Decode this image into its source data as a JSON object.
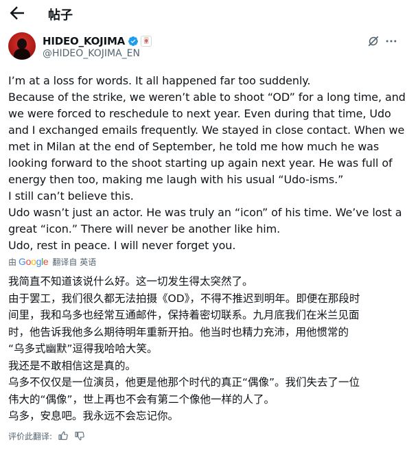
{
  "header": {
    "title": "帖子",
    "back_icon": "arrow-left-icon"
  },
  "author": {
    "display_name": "HIDEO_KOJIMA",
    "handle": "@HIDEO_KOJIMA_EN",
    "verified_icon": "verified-badge-icon",
    "affiliate_icon": "affiliate-badge-icon",
    "affiliate_text": "🀄"
  },
  "actions": {
    "grok_icon": "grok-icon",
    "more_icon": "more-icon"
  },
  "tweet": {
    "lines": [
      "I’m at a loss for words. It all happened far too suddenly.",
      "Because of the strike, we weren’t able to shoot “OD” for a long time, and",
      "we were forced to reschedule to next year. Even during that time, Udo",
      "and I exchanged emails frequently. We stayed in close contact. When we",
      "met in Milan at the end of September, he told me how much he was",
      "looking forward to the shoot starting up again next year. He was full of",
      "energy then too, making me laugh with his usual “Udo-isms.”",
      "I still can’t believe this.",
      "Udo wasn’t just an actor. He was truly an “icon” of his time. We’ve lost a",
      "great “icon.” There will never be another like him.",
      "Udo, rest in peace. I will never forget you."
    ]
  },
  "translation": {
    "by_label": "由",
    "google": "Google",
    "link_label": "翻译自 英语",
    "lines": [
      "我简直不知道该说什么好。这一切发生得太突然了。",
      "由于罢工，我们很久都无法拍摄《OD》，不得不推迟到明年。即便在那段时",
      "间里，我和乌多也经常互通邮件，保持着密切联系。九月底我们在米兰见面",
      "时，他告诉我他多么期待明年重新开拍。他当时也精力充沛，用他惯常的",
      "“乌多式幽默”逗得我哈哈大笑。",
      "我还是不敢相信这是真的。",
      "乌多不仅仅是一位演员，他更是他那个时代的真正“偶像”。我们失去了一位",
      "伟大的“偶像”，世上再也不会有第二个像他一样的人了。",
      "乌多，安息吧。我永远不会忘记你。"
    ],
    "rate_label": "评价此翻译:",
    "thumb_up_icon": "thumbs-up-icon",
    "thumb_down_icon": "thumbs-down-icon"
  },
  "colors": {
    "text": "#0f1419",
    "secondary": "#536471",
    "verified": "#1d9bf0",
    "google_blue": "#4285F4",
    "google_red": "#EA4335",
    "google_yellow": "#FBBC05",
    "google_green": "#34A853"
  }
}
